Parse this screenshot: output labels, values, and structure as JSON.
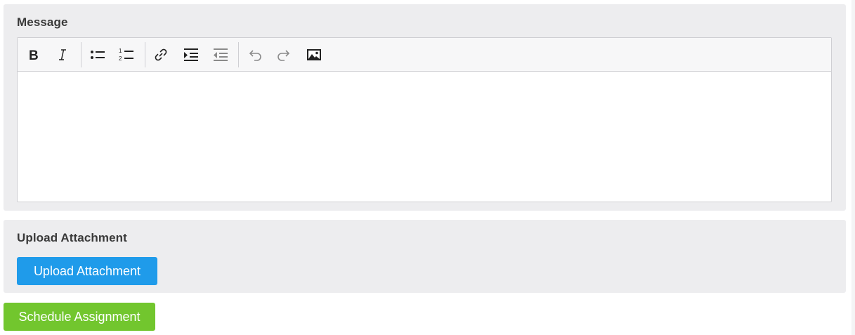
{
  "message_section": {
    "label": "Message",
    "toolbar": {
      "buttons": [
        {
          "name": "bold",
          "icon": "bold-icon"
        },
        {
          "name": "italic",
          "icon": "italic-icon"
        },
        {
          "name": "bulleted-list",
          "icon": "bulleted-list-icon"
        },
        {
          "name": "numbered-list",
          "icon": "numbered-list-icon"
        },
        {
          "name": "link",
          "icon": "link-icon"
        },
        {
          "name": "indent",
          "icon": "indent-icon"
        },
        {
          "name": "outdent",
          "icon": "outdent-icon"
        },
        {
          "name": "undo",
          "icon": "undo-icon"
        },
        {
          "name": "redo",
          "icon": "redo-icon"
        },
        {
          "name": "insert-image",
          "icon": "image-icon"
        }
      ]
    },
    "content": ""
  },
  "upload_section": {
    "label": "Upload Attachment",
    "button_label": "Upload Attachment"
  },
  "schedule_button_label": "Schedule Assignment",
  "colors": {
    "panel_bg": "#ededef",
    "upload_button": "#1f9bea",
    "schedule_button": "#72c62e"
  }
}
